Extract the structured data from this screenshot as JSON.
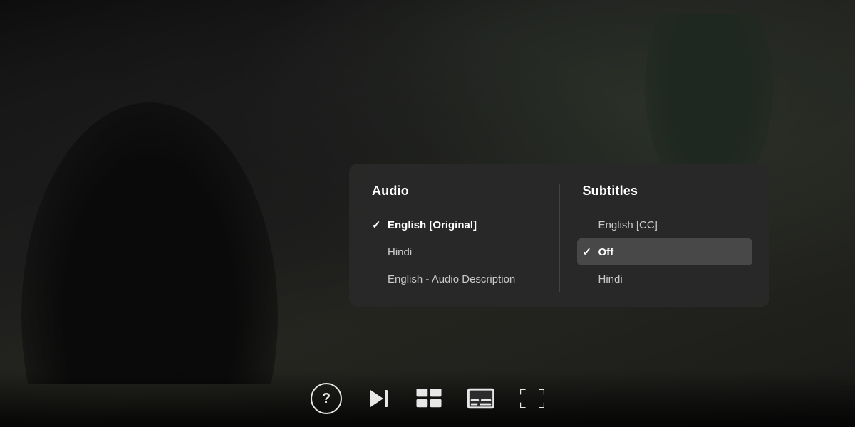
{
  "background": {
    "description": "Dark cinematic scene with silhouettes"
  },
  "panel": {
    "audio": {
      "header": "Audio",
      "items": [
        {
          "label": "English [Original]",
          "selected": true
        },
        {
          "label": "Hindi",
          "selected": false
        },
        {
          "label": "English - Audio Description",
          "selected": false
        }
      ]
    },
    "subtitles": {
      "header": "Subtitles",
      "items": [
        {
          "label": "English [CC]",
          "selected": false,
          "highlighted": false
        },
        {
          "label": "Off",
          "selected": true,
          "highlighted": true
        },
        {
          "label": "Hindi",
          "selected": false,
          "highlighted": false
        }
      ]
    }
  },
  "controls": {
    "help_label": "?",
    "buttons": [
      {
        "name": "help",
        "icon": "?"
      },
      {
        "name": "skip-next",
        "icon": "skip"
      },
      {
        "name": "episodes",
        "icon": "episodes"
      },
      {
        "name": "subtitles",
        "icon": "subtitles"
      },
      {
        "name": "fullscreen",
        "icon": "fullscreen"
      }
    ]
  }
}
